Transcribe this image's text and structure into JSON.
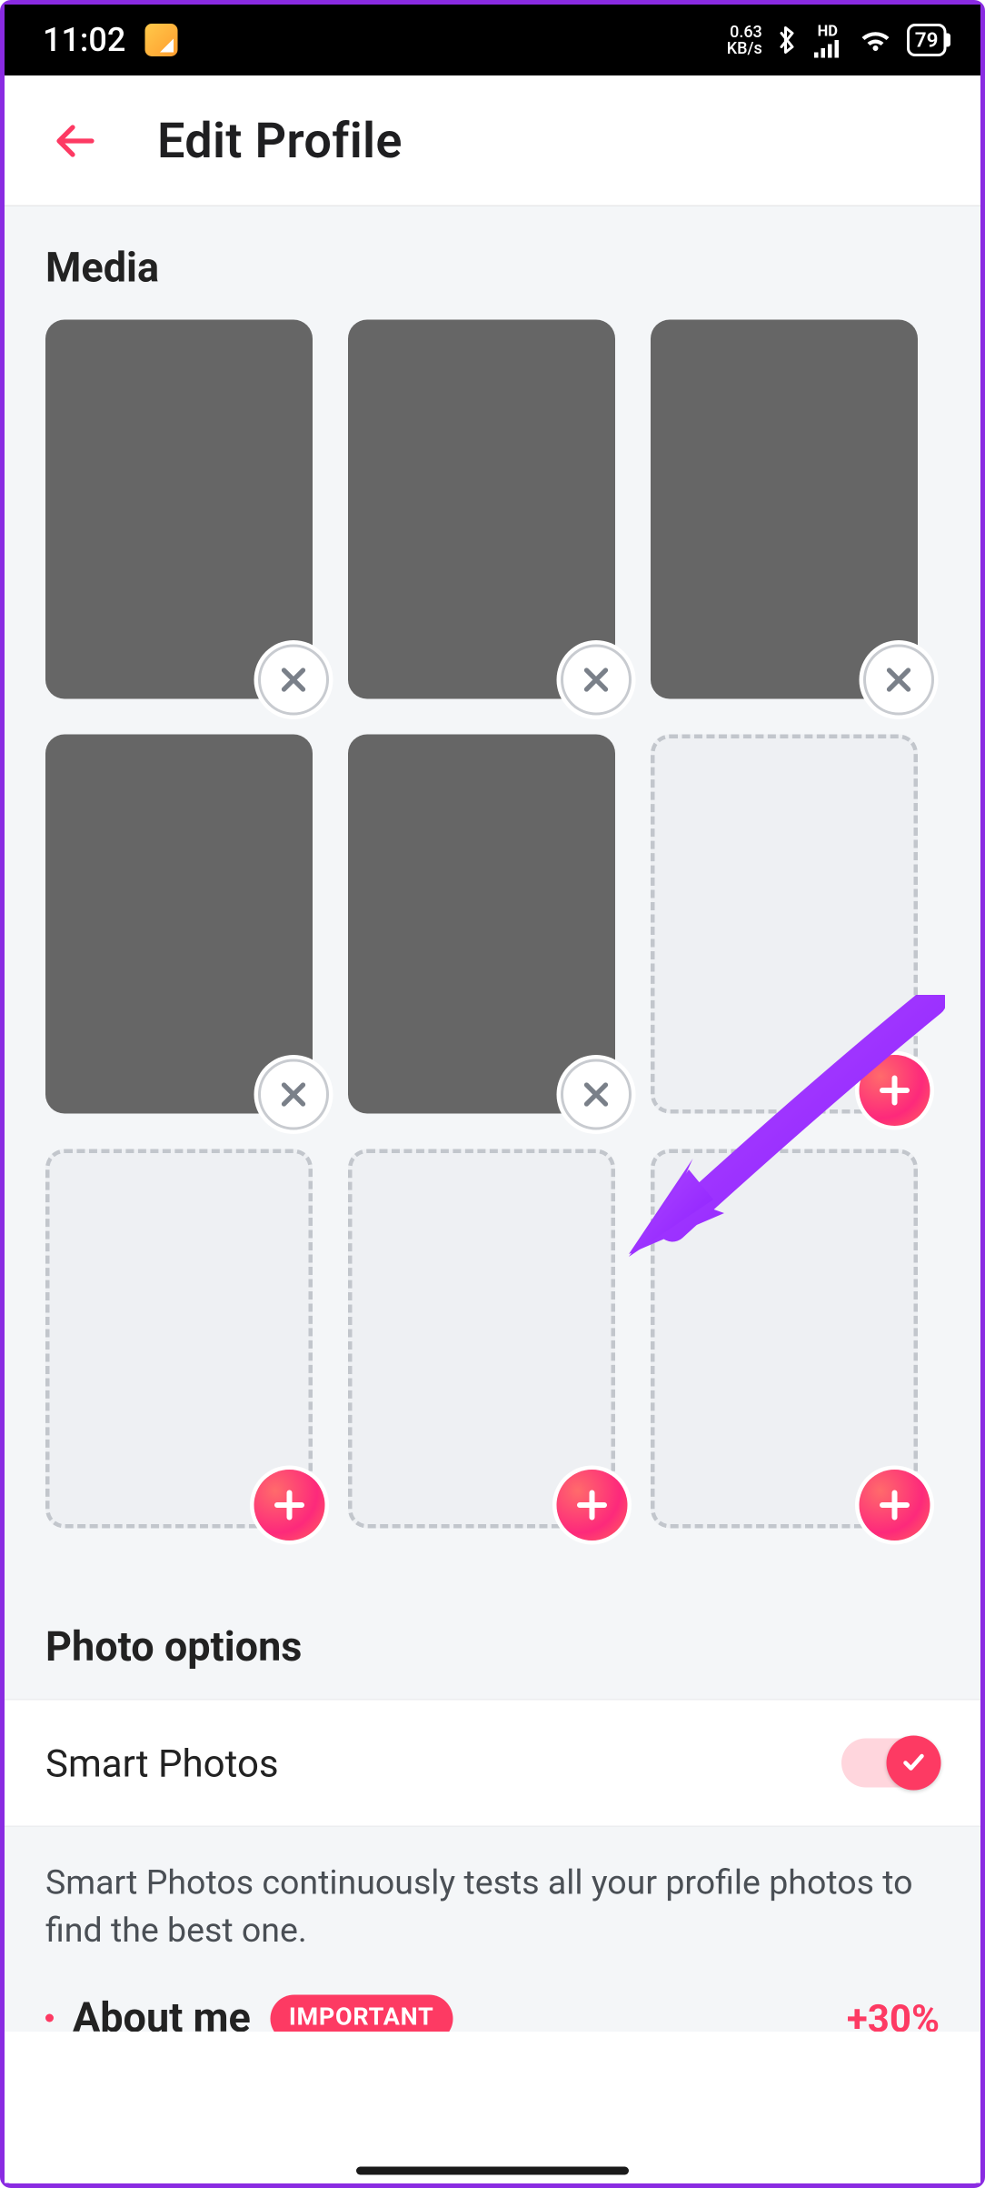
{
  "status": {
    "time": "11:02",
    "kbps_top": "0.63",
    "kbps_bottom": "KB/s",
    "hd": "HD",
    "battery": "79"
  },
  "header": {
    "title": "Edit Profile"
  },
  "media": {
    "section_title": "Media",
    "slots": [
      {
        "type": "filled"
      },
      {
        "type": "filled"
      },
      {
        "type": "filled"
      },
      {
        "type": "filled"
      },
      {
        "type": "filled"
      },
      {
        "type": "empty"
      },
      {
        "type": "empty"
      },
      {
        "type": "empty"
      },
      {
        "type": "empty"
      }
    ]
  },
  "photo_options": {
    "section_title": "Photo options",
    "smart_photos_label": "Smart Photos",
    "smart_photos_on": true,
    "description": "Smart Photos continuously tests all your profile photos to find the best one."
  },
  "about": {
    "label": "About me",
    "pill": "IMPORTANT",
    "pct": "+30%"
  },
  "colors": {
    "accent": "#fd3a63",
    "annotation": "#9b2fff"
  }
}
